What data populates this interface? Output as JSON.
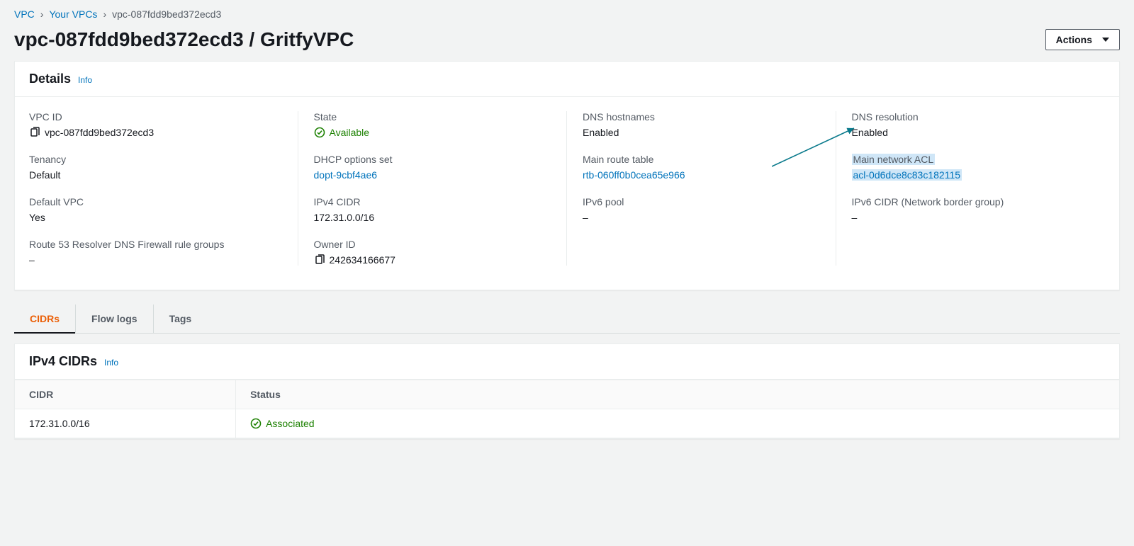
{
  "breadcrumb": {
    "root": "VPC",
    "level1": "Your VPCs",
    "current": "vpc-087fdd9bed372ecd3"
  },
  "header": {
    "title": "vpc-087fdd9bed372ecd3 / GritfyVPC",
    "actions_label": "Actions"
  },
  "details": {
    "panel_title": "Details",
    "info": "Info",
    "items": {
      "vpc_id": {
        "label": "VPC ID",
        "value": "vpc-087fdd9bed372ecd3"
      },
      "state": {
        "label": "State",
        "value": "Available"
      },
      "dns_hostnames": {
        "label": "DNS hostnames",
        "value": "Enabled"
      },
      "dns_resolution": {
        "label": "DNS resolution",
        "value": "Enabled"
      },
      "tenancy": {
        "label": "Tenancy",
        "value": "Default"
      },
      "dhcp": {
        "label": "DHCP options set",
        "value": "dopt-9cbf4ae6"
      },
      "main_rtb": {
        "label": "Main route table",
        "value": "rtb-060ff0b0cea65e966"
      },
      "main_acl": {
        "label": "Main network ACL",
        "value": "acl-0d6dce8c83c182115"
      },
      "default_vpc": {
        "label": "Default VPC",
        "value": "Yes"
      },
      "ipv4_cidr": {
        "label": "IPv4 CIDR",
        "value": "172.31.0.0/16"
      },
      "ipv6_pool": {
        "label": "IPv6 pool",
        "value": "–"
      },
      "ipv6_cidr": {
        "label": "IPv6 CIDR (Network border group)",
        "value": "–"
      },
      "r53_fw": {
        "label": "Route 53 Resolver DNS Firewall rule groups",
        "value": "–"
      },
      "owner_id": {
        "label": "Owner ID",
        "value": "242634166677"
      }
    }
  },
  "tabs": {
    "cidrs": "CIDRs",
    "flow_logs": "Flow logs",
    "tags": "Tags"
  },
  "cidr_panel": {
    "title": "IPv4 CIDRs",
    "info": "Info",
    "columns": {
      "cidr": "CIDR",
      "status": "Status"
    },
    "rows": [
      {
        "cidr": "172.31.0.0/16",
        "status": "Associated"
      }
    ]
  }
}
